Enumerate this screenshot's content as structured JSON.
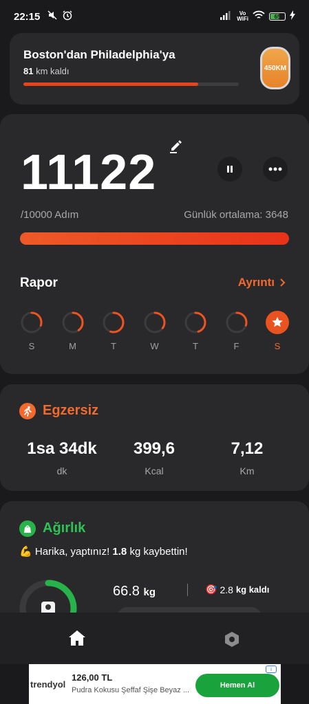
{
  "status_bar": {
    "time": "22:15",
    "volte_top": "Vo",
    "volte_bottom": "WiFi",
    "battery": "65"
  },
  "route": {
    "title": "Boston'dan Philadelphia'ya",
    "km_value": "81",
    "km_label": "km kaldı",
    "badge": "450KM"
  },
  "steps": {
    "count": "11122",
    "goal": "/10000 Adım",
    "average": "Günlük ortalama: 3648",
    "progress_fraction": 1.0
  },
  "report": {
    "title": "Rapor",
    "detail_link": "Ayrıntı",
    "days": [
      {
        "label": "S",
        "progress": 0.3,
        "active": false
      },
      {
        "label": "M",
        "progress": 0.4,
        "active": false
      },
      {
        "label": "T",
        "progress": 0.55,
        "active": false
      },
      {
        "label": "W",
        "progress": 0.35,
        "active": false
      },
      {
        "label": "T",
        "progress": 0.45,
        "active": false
      },
      {
        "label": "F",
        "progress": 0.3,
        "active": false
      },
      {
        "label": "S",
        "progress": 1.0,
        "active": true
      }
    ]
  },
  "exercise": {
    "title": "Egzersiz",
    "stats": [
      {
        "value": "1sa 34dk",
        "unit": "dk"
      },
      {
        "value": "399,6",
        "unit": "Kcal"
      },
      {
        "value": "7,12",
        "unit": "Km"
      }
    ]
  },
  "weight": {
    "title": "Ağırlık",
    "message_prefix": "Harika, yaptınız!",
    "message_amount": "1.8",
    "message_suffix": "kg kaybettin!",
    "current_value": "66.8",
    "current_unit": "kg",
    "remaining_value": "2.8",
    "remaining_unit": "kg kaldı",
    "ring_progress": 0.4
  },
  "nav": {
    "items": [
      "home-icon",
      "settings-icon"
    ]
  },
  "ad": {
    "brand": "trendyol",
    "price": "126,00 TL",
    "description": "Pudra Kokusu Şeffaf Şişe Beyaz ...",
    "button": "Hemen Al",
    "info": "i"
  },
  "colors": {
    "accent_orange": "#f26a2e",
    "accent_green": "#2fc255",
    "card_bg": "#29292b",
    "page_bg": "#1a1a1c"
  }
}
